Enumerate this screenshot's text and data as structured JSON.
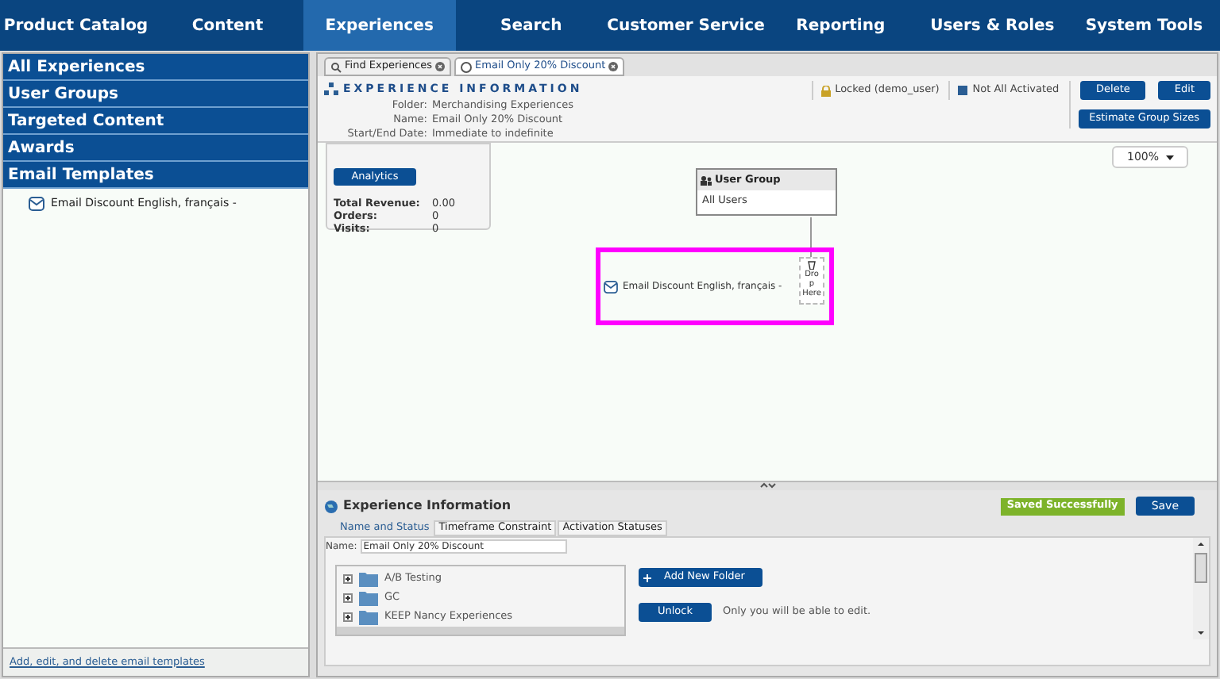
{
  "nav": [
    {
      "label": "Product Catalog",
      "selected": false
    },
    {
      "label": "Content",
      "selected": false
    },
    {
      "label": "Experiences",
      "selected": true
    },
    {
      "label": "Search",
      "selected": false
    },
    {
      "label": "Customer Service",
      "selected": false
    },
    {
      "label": "Reporting",
      "selected": false
    },
    {
      "label": "Users & Roles",
      "selected": false
    },
    {
      "label": "System Tools",
      "selected": false
    }
  ],
  "sidebar": {
    "sections": [
      {
        "label": "All Experiences"
      },
      {
        "label": "User Groups"
      },
      {
        "label": "Targeted Content"
      },
      {
        "label": "Awards"
      },
      {
        "label": "Email Templates",
        "items": [
          "Email Discount English, français -"
        ]
      }
    ],
    "footer_link": "Add, edit, and delete email templates"
  },
  "tabs": [
    {
      "label": "Find Experiences",
      "kind": "search",
      "selected": false
    },
    {
      "label": "Email Only 20% Discount",
      "kind": "experience",
      "selected": true
    }
  ],
  "header": {
    "title": "EXPERIENCE INFORMATION",
    "fields": [
      {
        "label": "Folder:",
        "value": "Merchandising Experiences"
      },
      {
        "label": "Name:",
        "value": "Email Only 20% Discount"
      },
      {
        "label": "Start/End Date:",
        "value": "Immediate to indefinite"
      }
    ],
    "locked": "Locked (demo_user)",
    "activation": "Not All Activated",
    "buttons": [
      "Delete",
      "Edit"
    ],
    "estimate": "Estimate Group Sizes"
  },
  "analytics": {
    "button": "Analytics",
    "stats": [
      {
        "label": "Total Revenue:",
        "value": "0.00"
      },
      {
        "label": "Orders:",
        "value": "0"
      },
      {
        "label": "Visits:",
        "value": "0"
      }
    ]
  },
  "zoom": "100%",
  "diagram": {
    "group_title": "User Group",
    "group_value": "All Users",
    "email": "Email Discount English, français -",
    "drop": "Drop Here"
  },
  "bottom": {
    "title": "Experience Information",
    "status": "Saved Successfully",
    "save": "Save",
    "tabs": [
      {
        "label": "Name and Status",
        "selected": true
      },
      {
        "label": "Timeframe Constraint",
        "selected": false
      },
      {
        "label": "Activation Statuses",
        "selected": false
      }
    ],
    "name_label": "Name:",
    "name_value": "Email Only 20% Discount",
    "folders": [
      {
        "label": "A/B Testing",
        "expanded": false
      },
      {
        "label": "GC",
        "expanded": false
      },
      {
        "label": "KEEP Nancy Experiences",
        "expanded": false
      }
    ],
    "add_folder": "Add New Folder",
    "unlock": "Unlock",
    "unlock_note": "Only you will be able to edit."
  }
}
